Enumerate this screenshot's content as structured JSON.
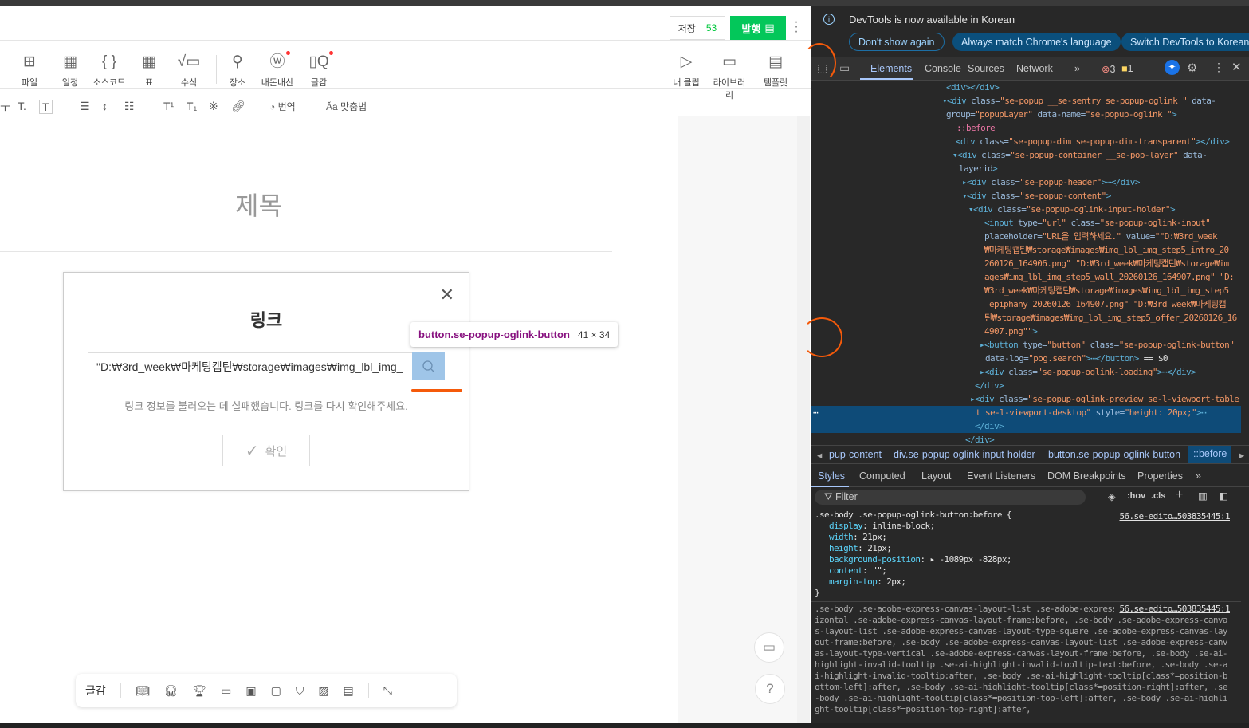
{
  "editor": {
    "save_label": "저장",
    "save_count": "53",
    "publish_label": "발행",
    "tools": [
      {
        "icon": "file-add-icon",
        "label": "파일"
      },
      {
        "icon": "calendar-icon",
        "label": "일정"
      },
      {
        "icon": "code-braces-icon",
        "label": "소스코드"
      },
      {
        "icon": "table-icon",
        "label": "표"
      },
      {
        "icon": "formula-icon",
        "label": "수식"
      },
      {
        "icon": "location-pin-icon",
        "label": "장소"
      },
      {
        "icon": "my-money-icon",
        "label": "내돈내산"
      },
      {
        "icon": "book-search-icon",
        "label": "글감"
      }
    ],
    "right_tools": [
      {
        "icon": "play-clip-icon",
        "label": "내 클립"
      },
      {
        "icon": "library-icon",
        "label": "라이브러리"
      },
      {
        "icon": "template-icon",
        "label": "템플릿"
      }
    ],
    "format": {
      "translate": "번역",
      "spellcheck": "맞춤법"
    },
    "title_placeholder": "제목",
    "bottom_label": "글감"
  },
  "popup": {
    "title": "링크",
    "input_value": "\"D:₩3rd_week₩마케팅캡틴₩storage₩images₩img_lbl_img_",
    "input_placeholder": "URL을 입력하세요.",
    "error": "링크 정보를 불러오는 데 실패했습니다. 링크를 다시 확인해주세요.",
    "ok_label": "확인"
  },
  "tooltip": {
    "selector_tag": "button",
    "selector_class": ".se-popup-oglink-button",
    "size": "41 × 34"
  },
  "devtools": {
    "info": "DevTools is now available in Korean",
    "btn_dont_show": "Don't show again",
    "btn_match": "Always match Chrome's language",
    "btn_switch": "Switch DevTools to Korean",
    "tabs": [
      "Elements",
      "Console",
      "Sources",
      "Network"
    ],
    "errors": "3",
    "warnings": "1",
    "tree": [
      [
        [
          "tg",
          "<div></div>"
        ]
      ],
      [
        [
          "tg",
          "▾<div "
        ],
        [
          "at",
          "class="
        ],
        [
          "av",
          "\"se-popup __se-sentry se-popup-oglink \""
        ],
        [
          "at",
          " data-"
        ]
      ],
      [
        [
          "at",
          "group="
        ],
        [
          "av",
          "\"popupLayer\""
        ],
        [
          "at",
          " data-name="
        ],
        [
          "av",
          "\"se-popup-oglink \""
        ],
        [
          "tg",
          ">"
        ]
      ],
      [
        [
          "ps",
          "::before"
        ]
      ],
      [
        [
          "tg",
          "<div "
        ],
        [
          "at",
          "class="
        ],
        [
          "av",
          "\"se-popup-dim se-popup-dim-transparent\""
        ],
        [
          "tg",
          "></div>"
        ]
      ],
      [
        [
          "tg",
          "▾<div "
        ],
        [
          "at",
          "class="
        ],
        [
          "av",
          "\"se-popup-container __se-pop-layer\""
        ],
        [
          "at",
          " data-"
        ]
      ],
      [
        [
          "at",
          "layerid"
        ],
        [
          "tg",
          ">"
        ]
      ],
      [
        [
          "tg",
          "▸<div "
        ],
        [
          "at",
          "class="
        ],
        [
          "av",
          "\"se-popup-header\""
        ],
        [
          "tg",
          ">⋯</div>"
        ]
      ],
      [
        [
          "tg",
          "▾<div "
        ],
        [
          "at",
          "class="
        ],
        [
          "av",
          "\"se-popup-content\""
        ],
        [
          "tg",
          ">"
        ]
      ],
      [
        [
          "tg",
          "▾<div "
        ],
        [
          "at",
          "class="
        ],
        [
          "av",
          "\"se-popup-oglink-input-holder\""
        ],
        [
          "tg",
          ">"
        ]
      ],
      [
        [
          "tg",
          "<input "
        ],
        [
          "at",
          "type="
        ],
        [
          "av",
          "\"url\""
        ],
        [
          "at",
          " class="
        ],
        [
          "av",
          "\"se-popup-oglink-input\""
        ]
      ],
      [
        [
          "at",
          "placeholder="
        ],
        [
          "av",
          "\"URL을 입력하세요.\""
        ],
        [
          "at",
          " value="
        ],
        [
          "av",
          "\"\"D:₩3rd_week"
        ]
      ],
      [
        [
          "av",
          "₩마케팅캡틴₩storage₩images₩img_lbl_img_step5_intro_20"
        ]
      ],
      [
        [
          "av",
          "260126_164906.png\" \"D:₩3rd_week₩마케팅캡틴₩storage₩im"
        ]
      ],
      [
        [
          "av",
          "ages₩img_lbl_img_step5_wall_20260126_164907.png\" \"D:"
        ]
      ],
      [
        [
          "av",
          "₩3rd_week₩마케팅캡틴₩storage₩images₩img_lbl_img_step5"
        ]
      ],
      [
        [
          "av",
          "_epiphany_20260126_164907.png\" \"D:₩3rd_week₩마케팅캡"
        ]
      ],
      [
        [
          "av",
          "틴₩storage₩images₩img_lbl_img_step5_offer_20260126_16"
        ]
      ],
      [
        [
          "av",
          "4907.png\"\""
        ],
        [
          "tg",
          ">"
        ]
      ],
      [
        [
          "tg",
          "▸<button "
        ],
        [
          "at",
          "type="
        ],
        [
          "av",
          "\"button\""
        ],
        [
          "at",
          " class="
        ],
        [
          "av",
          "\"se-popup-oglink-button\""
        ]
      ],
      [
        [
          "at",
          "data-log="
        ],
        [
          "av",
          "\"pog.search\""
        ],
        [
          "tg",
          ">⋯</button>"
        ],
        [
          "tx",
          " == $0"
        ]
      ],
      [
        [
          "tg",
          "▸<div "
        ],
        [
          "at",
          "class="
        ],
        [
          "av",
          "\"se-popup-oglink-loading\""
        ],
        [
          "tg",
          ">⋯</div>"
        ]
      ],
      [
        [
          "tg",
          "</div>"
        ]
      ],
      [
        [
          "tg",
          "▸<div "
        ],
        [
          "at",
          "class="
        ],
        [
          "av",
          "\"se-popup-oglink-preview se-l-viewport-table"
        ]
      ],
      [
        [
          "av",
          "t se-l-viewport-desktop\""
        ],
        [
          "at",
          " style="
        ],
        [
          "av",
          "\"height: 20px;\""
        ],
        [
          "tg",
          ">⋯"
        ]
      ],
      [
        [
          "tg",
          "</div>"
        ]
      ],
      [
        [
          "tg",
          "</div>"
        ]
      ]
    ],
    "crumbs": [
      "pup-content",
      "div.se-popup-oglink-input-holder",
      "button.se-popup-oglink-button",
      "::before"
    ],
    "style_tabs": [
      "Styles",
      "Computed",
      "Layout",
      "Event Listeners",
      "DOM Breakpoints",
      "Properties"
    ],
    "filter_placeholder": "Filter",
    "hov": ":hov",
    "cls": ".cls",
    "rule1": {
      "selector": ".se-body .se-popup-oglink-button:before {",
      "source": "56.se-edito…503835445:1",
      "props": [
        [
          "display",
          "inline-block;"
        ],
        [
          "width",
          "21px;"
        ],
        [
          "height",
          "21px;"
        ],
        [
          "background-position",
          "▸ -1089px -828px;"
        ],
        [
          "content",
          "\"\";"
        ],
        [
          "margin-top",
          "2px;"
        ]
      ],
      "close": "}"
    },
    "rule2": {
      "source": "56.se-edito…503835445:1",
      "text": ".se-body .se-adobe-express-canvas-layout-list .se-adobe-express-canvas-layout-type-horizontal .se-adobe-express-canvas-layout-frame:before, .se-body .se-adobe-express-canvas-layout-list .se-adobe-express-canvas-layout-type-square .se-adobe-express-canvas-layout-frame:before, .se-body .se-adobe-express-canvas-layout-list .se-adobe-express-canvas-layout-type-vertical .se-adobe-express-canvas-layout-frame:before, .se-body .se-ai-highlight-invalid-tooltip .se-ai-highlight-invalid-tooltip-text:before, .se-body .se-ai-highlight-invalid-tooltip:after, .se-body .se-ai-highlight-tooltip[class*=position-bottom-left]:after, .se-body .se-ai-highlight-tooltip[class*=position-right]:after, .se-body .se-ai-highlight-tooltip[class*=position-top-left]:after, .se-body .se-ai-highlight-tooltip[class*=position-top-right]:after,"
    }
  }
}
